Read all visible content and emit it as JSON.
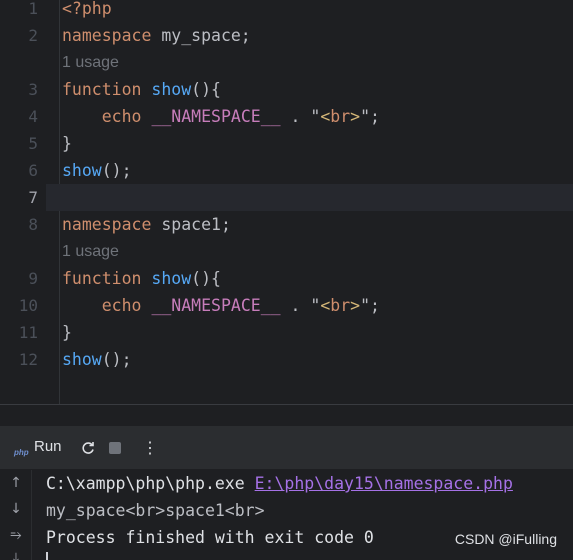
{
  "editor": {
    "lines": [
      {
        "n": "1",
        "code": "<?php"
      },
      {
        "n": "2",
        "kw": "namespace",
        "rest": " my_space;"
      },
      {
        "hint": "1 usage"
      },
      {
        "n": "3",
        "kw": "function",
        "fn": "show",
        "rest": "(){"
      },
      {
        "n": "4",
        "echo": "echo",
        "const": "__NAMESPACE__",
        "mid": " . \"",
        "tag_open": "<",
        "tag_name": "br",
        "tag_close": ">",
        "end": "\";"
      },
      {
        "n": "5",
        "code": "}"
      },
      {
        "n": "6",
        "fn": "show",
        "rest": "();"
      },
      {
        "n": "7",
        "code": ""
      },
      {
        "n": "8",
        "kw": "namespace",
        "rest": " space1;"
      },
      {
        "hint": "1 usage"
      },
      {
        "n": "9",
        "kw": "function",
        "fn": "show",
        "rest": "(){"
      },
      {
        "n": "10",
        "echo": "echo",
        "const": "__NAMESPACE__",
        "mid": " . \"",
        "tag_open": "<",
        "tag_name": "br",
        "tag_close": ">",
        "end": "\";"
      },
      {
        "n": "11",
        "code": "}"
      },
      {
        "n": "12",
        "fn": "show",
        "rest": "();"
      }
    ]
  },
  "run_panel": {
    "tab_label": "Run",
    "php_icon_text": "php",
    "icons": [
      "rerun-icon",
      "stop-icon",
      "more-vertical-icon"
    ],
    "more_glyph": "⋮"
  },
  "console": {
    "rail_icons": [
      "arrow-up-icon",
      "arrow-down-icon",
      "soft-wrap-icon",
      "scroll-to-end-icon"
    ],
    "line1_cmd": "C:\\xampp\\php\\php.exe ",
    "line1_link": "E:\\php\\day15\\namespace.php",
    "line2": "my_space<br>space1<br>",
    "line3": "Process finished with exit code 0"
  },
  "watermark": "CSDN @iFulling",
  "colors": {
    "background": "#1e1f22",
    "keyword": "#cf8e6d",
    "function": "#56a8f5",
    "constant": "#c77dbb",
    "string": "#6aab73",
    "link": "#a571e6"
  }
}
